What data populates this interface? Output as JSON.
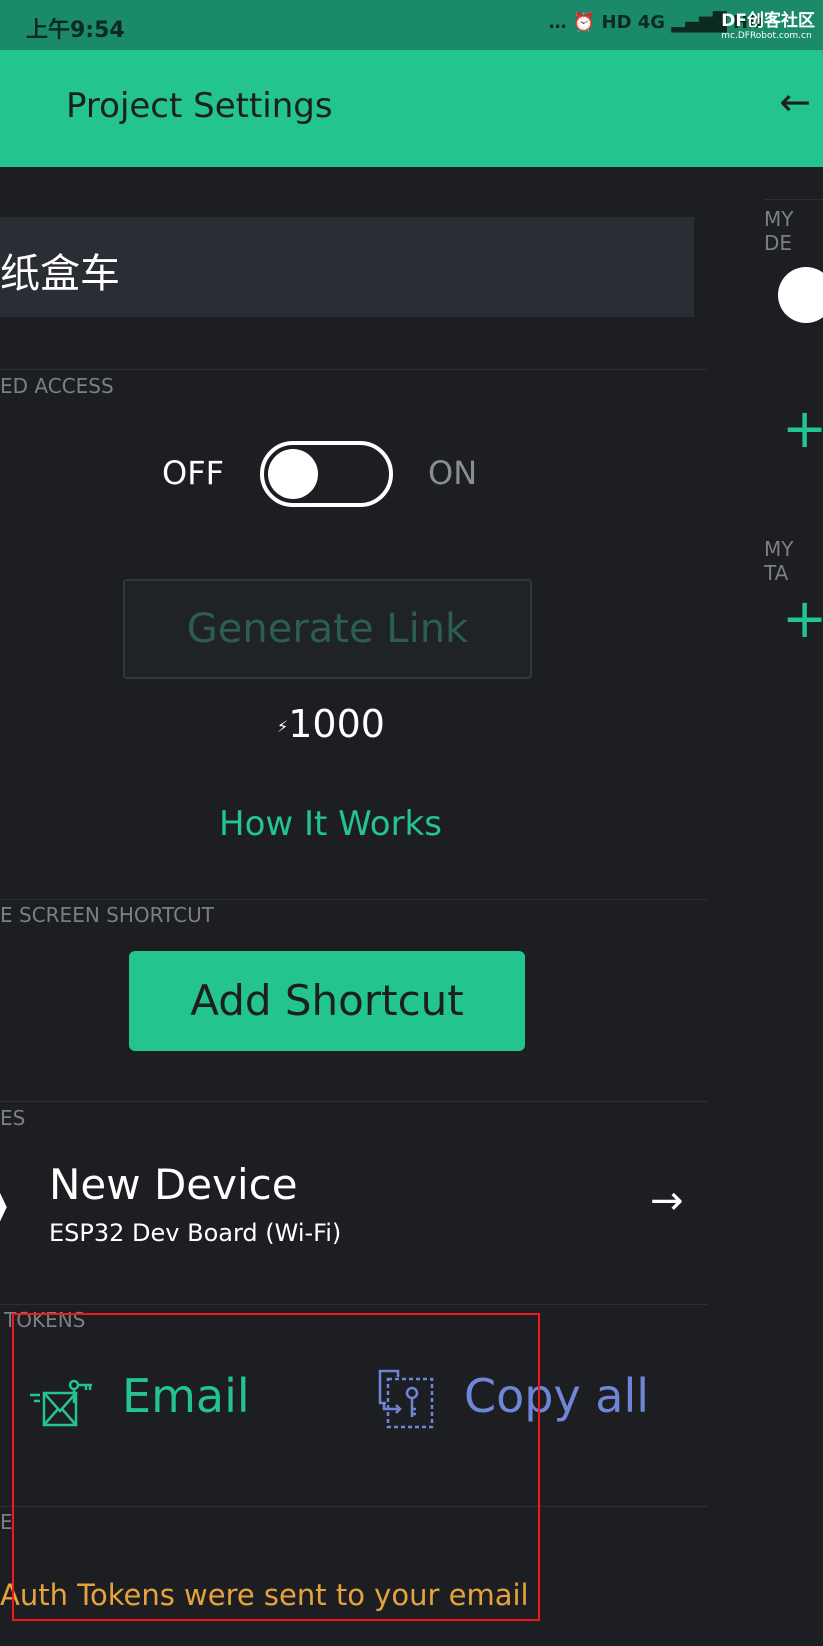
{
  "status_bar": {
    "time": "上午9:54",
    "icons": "… ⏰ HD 4G ▂▄▆█ HD",
    "watermark_brand": "DF创客社区",
    "watermark_url": "mc.DFRobot.com.cn"
  },
  "app_bar": {
    "title": "Project Settings",
    "back_icon": "arrow-left"
  },
  "project_name": "纸盒车",
  "shared_access": {
    "section": "ED ACCESS",
    "off_label": "OFF",
    "on_label": "ON",
    "toggle_on": false,
    "generate_link": "Generate Link",
    "energy_icon": "⚡",
    "energy_cost": "1000",
    "how_it_works": "How It Works"
  },
  "home_screen": {
    "section": "E SCREEN SHORTCUT",
    "add_shortcut": "Add Shortcut"
  },
  "devices": {
    "section": "ES",
    "device_name": "New Device",
    "device_type": "ESP32 Dev Board (Wi-Fi)"
  },
  "auth_tokens": {
    "section": "TOKENS",
    "email_label": "Email",
    "copy_all_label": "Copy all"
  },
  "theme": {
    "section": "E"
  },
  "message": "Auth Tokens were sent to your email",
  "right_panel": {
    "my_devices": "MY DE",
    "my_tags": "MY TA"
  },
  "colors": {
    "accent": "#23c48e",
    "copy": "#6f86d6",
    "message": "#e6a23c",
    "highlight_box": "#f01818"
  }
}
